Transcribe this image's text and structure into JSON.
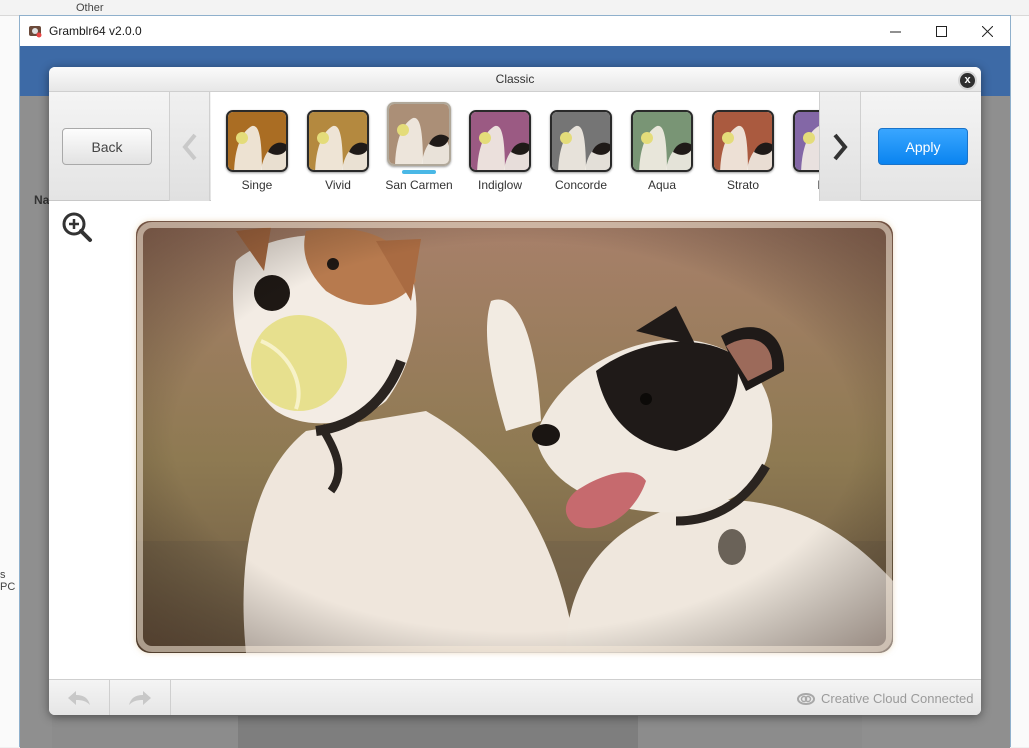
{
  "window": {
    "title": "Gramblr64 v2.0.0"
  },
  "background": {
    "top_text": "Other",
    "left_text_1": "Na",
    "left_text_2": "s PC"
  },
  "modal": {
    "title": "Classic",
    "close_label": "x",
    "back_label": "Back",
    "apply_label": "Apply",
    "filters": [
      {
        "label": "Singe",
        "tint": "#c8802a",
        "selected": false
      },
      {
        "label": "Vivid",
        "tint": "#d4a14a",
        "selected": false
      },
      {
        "label": "San Carmen",
        "tint": "#c9a98c",
        "selected": true
      },
      {
        "label": "Indiglow",
        "tint": "#b76a9a",
        "selected": false
      },
      {
        "label": "Concorde",
        "tint": "#8a8a8a",
        "selected": false
      },
      {
        "label": "Aqua",
        "tint": "#8fb08a",
        "selected": false
      },
      {
        "label": "Strato",
        "tint": "#c86a4a",
        "selected": false
      },
      {
        "label": "La",
        "tint": "#9a7ac4",
        "selected": false
      }
    ],
    "footer": {
      "cc_label": "Creative Cloud Connected"
    }
  },
  "colors": {
    "accent_blue": "#0a84f0",
    "selection_bar": "#4ab8e6",
    "app_header": "#3d6aa6"
  }
}
